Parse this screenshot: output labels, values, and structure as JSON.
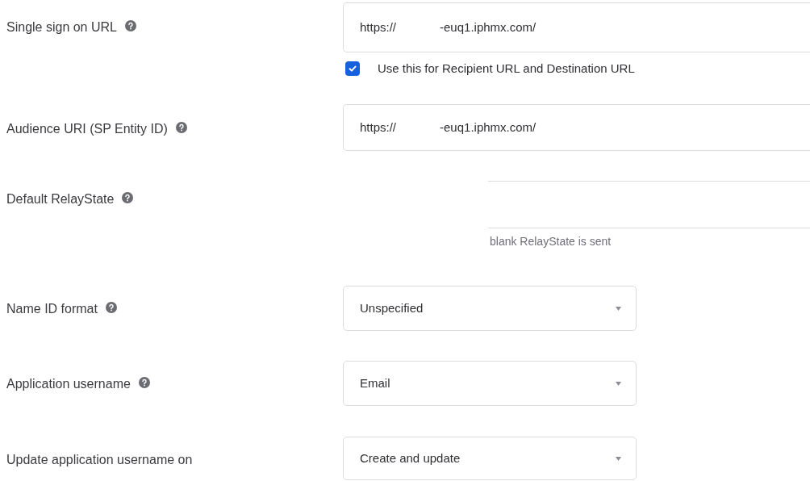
{
  "fields": [
    {
      "kind": "text",
      "label": "Single sign on URL",
      "help": true,
      "value_parts": [
        "https://",
        "-euq1.iphmx.com/"
      ],
      "checkbox": {
        "label": "Use this for Recipient URL and Destination URL",
        "checked": true
      }
    },
    {
      "kind": "text",
      "label": "Audience URI (SP Entity ID)",
      "help": true,
      "value_parts": [
        "https://",
        "-euq1.iphmx.com/"
      ]
    },
    {
      "kind": "partial",
      "label": "Default RelayState",
      "help": true,
      "hint": "blank RelayState is sent"
    },
    {
      "kind": "select",
      "label": "Name ID format",
      "help": true,
      "value": "Unspecified"
    },
    {
      "kind": "select",
      "label": "Application username",
      "help": true,
      "value": "Email"
    },
    {
      "kind": "select",
      "label": "Update application username on",
      "help": false,
      "value": "Create and update"
    }
  ]
}
